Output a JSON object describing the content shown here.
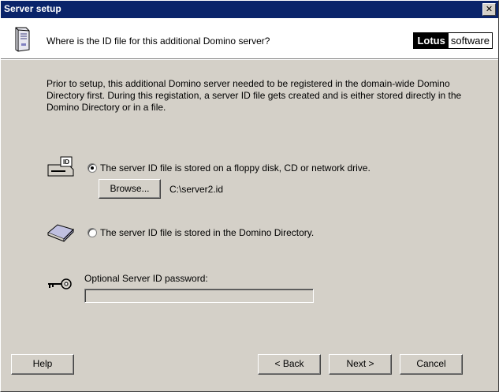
{
  "window": {
    "title": "Server setup"
  },
  "header": {
    "question": "Where is the ID file for this additional Domino server?",
    "logo_bold": "Lotus",
    "logo_light": "software",
    "icon": "server-tower-icon"
  },
  "intro_text": "Prior to setup, this additional Domino server needed to be registered in the domain-wide Domino Directory first. During this registation, a server ID file gets created and is either stored directly in the Domino Directory or in a file.",
  "options": {
    "file": {
      "label": "The server ID file is stored on a floppy disk, CD or network drive.",
      "selected": true,
      "icon": "id-disk-drive-icon",
      "browse_label": "Browse...",
      "path": "C:\\server2.id"
    },
    "directory": {
      "label": "The server ID file is stored in the Domino Directory.",
      "selected": false,
      "icon": "book-icon"
    }
  },
  "password": {
    "label": "Optional Server ID password:",
    "value": "",
    "icon": "key-icon"
  },
  "buttons": {
    "help": "Help",
    "back": "< Back",
    "next": "Next >",
    "cancel": "Cancel"
  }
}
